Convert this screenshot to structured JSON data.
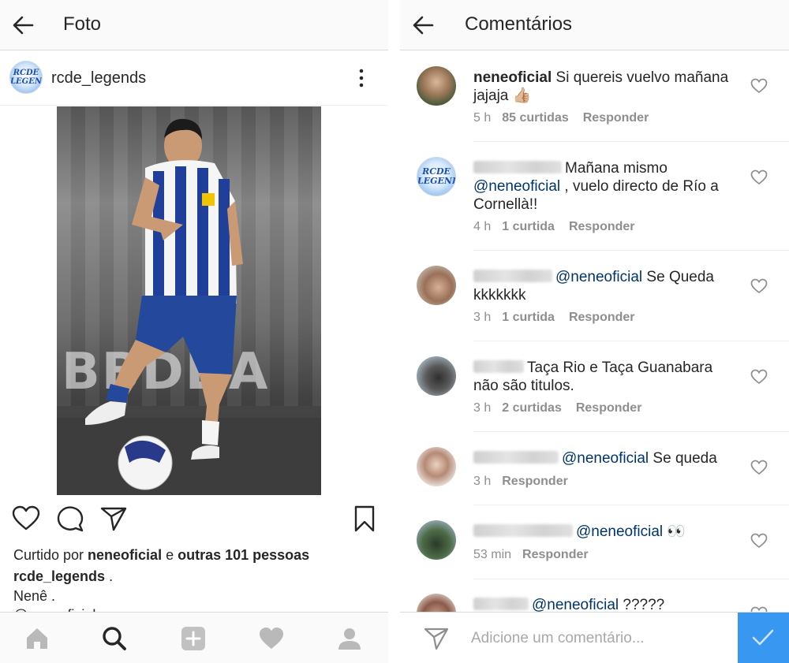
{
  "left": {
    "header": {
      "title": "Foto"
    },
    "post": {
      "username": "rcde_legends",
      "avatar_text": "RCDE LEGENDS",
      "photo_banner": "BBDDA",
      "likes_prefix": "Curtido por ",
      "likes_user": "neneoficial",
      "likes_mid": " e ",
      "likes_rest": "outras 101 pessoas",
      "caption_user": "rcde_legends",
      "caption_suffix": " .",
      "caption_text": "Nenê .",
      "cut_text": "@neneoficial"
    },
    "actions": [
      "heart-icon",
      "comment-icon",
      "send-icon",
      "bookmark-icon"
    ],
    "nav": [
      "home-icon",
      "search-icon",
      "add-icon",
      "heart-icon",
      "profile-icon"
    ]
  },
  "right": {
    "header": {
      "title": "Comentários"
    },
    "comments": [
      {
        "user": "neneoficial",
        "text": "Si quereis vuelvo mañana jajaja 👍🏼",
        "time": "5 h",
        "likes": "85 curtidas",
        "reply": "Responder"
      },
      {
        "mention": "@neneoficial",
        "text_pre": "Mañana mismo ",
        "text_post": " , vuelo directo de Río a Cornellà!!",
        "time": "4 h",
        "likes": "1 curtida",
        "reply": "Responder",
        "avatar_text": "RCDE LEGENDS"
      },
      {
        "mention": "@neneoficial",
        "text": " Se Queda kkkkkkk",
        "time": "3 h",
        "likes": "1 curtida",
        "reply": "Responder"
      },
      {
        "text": "Taça Rio e Taça Guanabara não são titulos.",
        "time": "3 h",
        "likes": "2 curtidas",
        "reply": "Responder"
      },
      {
        "mention": "@neneoficial",
        "text": " Se queda",
        "time": "3 h",
        "reply": "Responder"
      },
      {
        "mention": "@neneoficial",
        "text": " 👀",
        "time": "53 min",
        "reply": "Responder"
      },
      {
        "mention": "@neneoficial",
        "text": " ?????"
      }
    ],
    "input": {
      "placeholder": "Adicione um comentário..."
    },
    "colors": {
      "mention": "#003569",
      "accent": "#3897f0",
      "meta": "#8e8e8e"
    }
  }
}
